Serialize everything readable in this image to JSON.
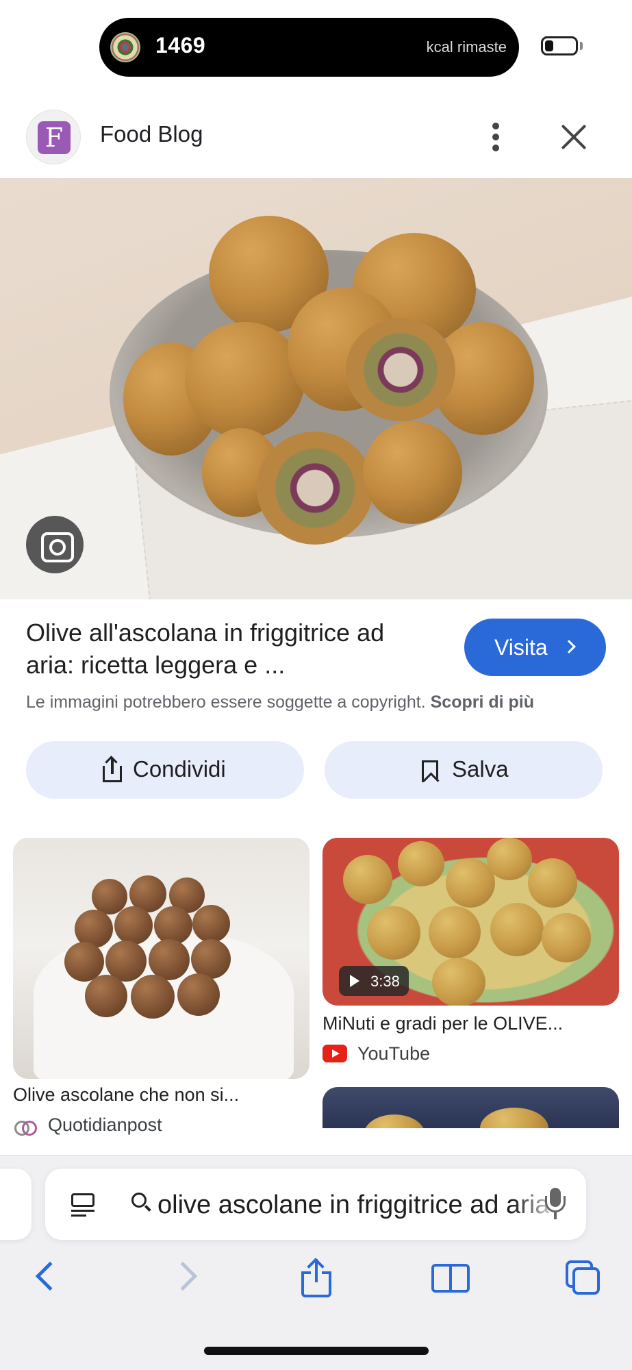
{
  "status_bar": {
    "kcal_value": "1469",
    "kcal_label": "kcal rimaste"
  },
  "header": {
    "site_initial": "F",
    "site_name": "Food Blog"
  },
  "result": {
    "title_line1": "Olive all'ascolana in friggitrice ad",
    "title_line2": "aria: ricetta leggera e ...",
    "visit_label": "Visita",
    "copyright_text": "Le immagini potrebbero essere soggette a copyright.",
    "copyright_link": "Scopri di più"
  },
  "actions": {
    "share_label": "Condividi",
    "save_label": "Salva"
  },
  "related": [
    {
      "title": "Olive ascolane che non si...",
      "source": "Quotidianpost"
    },
    {
      "title": "MiNuti e gradi per le OLIVE...",
      "source": "YouTube",
      "duration": "3:38"
    }
  ],
  "address_bar": {
    "query": "olive ascolane in friggitrice ad aria"
  },
  "colors": {
    "accent": "#2a6ad8",
    "button_bg": "#e8edfb",
    "site_icon": "#9b59b6"
  },
  "icons": {
    "more": "more-vert-icon",
    "close": "close-icon",
    "lens": "lens-icon",
    "share": "share-icon",
    "bookmark": "bookmark-icon",
    "mic": "microphone-icon",
    "reader": "reader-icon",
    "tabs": "tabs-icon"
  }
}
